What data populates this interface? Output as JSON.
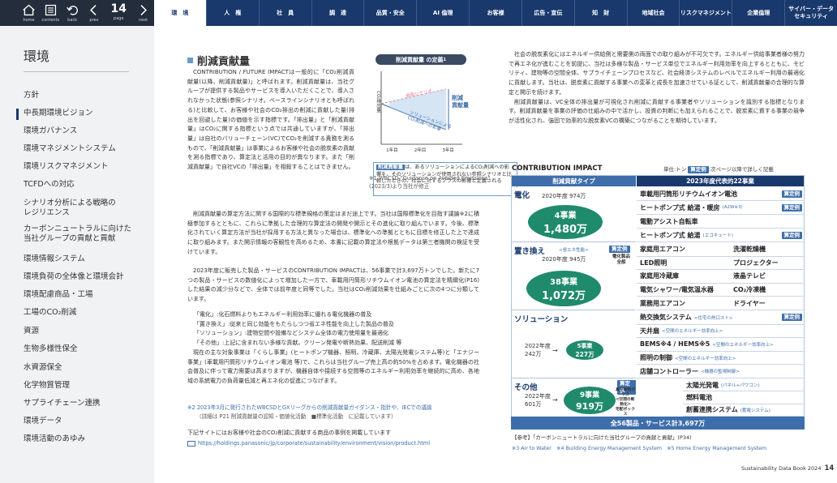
{
  "viewer": {
    "home": "home",
    "contents": "contents",
    "back": "back",
    "prev": "prev",
    "page": "14",
    "page_label": "page",
    "next": "next"
  },
  "tabs": [
    "環　境",
    "人　権",
    "社　員",
    "調　達",
    "品質・安全",
    "AI 倫理",
    "お客様",
    "広告・宣伝",
    "知　財",
    "地域社会",
    "リスクマネジメント",
    "企業倫理",
    "サイバー・データ\nセキュリティ"
  ],
  "sidebar": {
    "title": "環境",
    "items": [
      "方針",
      "中長期環境ビジョン",
      "環境ガバナンス",
      "環境マネジメントシステム",
      "環境リスクマネジメント",
      "TCFDへの対応",
      "シナリオ分析による戦略の\nレジリエンス",
      "カーボンニュートラルに向けた\n当社グループの貢献と貢献",
      "環境情報システム",
      "環境負荷の全体像と環境会計",
      "環境配慮商品・工場",
      "工場のCO₂削減",
      "資源",
      "生物多様性保全",
      "水資源保全",
      "化学物質管理",
      "サプライチェーン連携",
      "環境データ",
      "環境活動のあゆみ"
    ]
  },
  "section": {
    "title": "削減貢献量",
    "p1": "CONTRIBUTION / FUTURE IMPACTは一般的に「CO₂削減貢献量(以降、削減貢献量)」と呼ばれます。削減貢献量は、当社グループが提供する製品やサービスを導入いただくことで、導入されなかった状態(参照シナリオ。ベースラインシナリオとも呼ばれる)と比較して、お客様や社会のCO₂排出の削減に貢献した量(排出を回避した量)の価値を示す指標です。「排出量」と「削減貢献量」はCO₂に関する指標という点では共通していますが、「排出量」は自社のバリューチェーン(VC)でCO₂を削減する責務を測るもので、「削減貢献量」は事業によるお客様や社会の脱炭素の貢献を測る指標であり、算定法と活用の目的が異なります。また「削減貢献量」で自社VCの「排出量」を相殺することはできません。",
    "p2": "削減貢献量の算定方法に関する国際的な標準規格の策定はまだ途上です。当社は国際標準化を目指す議論※2に積極参加するとともに、これらに準拠した合理的な算定法の開発や開示とその進化に取り組んでいます。今後、標準化されていく算定方法が当社が採用する方法と異なった場合は、標準化への準拠とともに目標を修正した上で達成に取り組みます。また開示情報の客観性を高めるため、本書に記載の算定法や根拠データは第三者機関の検証を受けています。",
    "p3": "2023年度に販売した製品・サービスのCONTRIBUTION IMPACTは、56事業で計3,697万トンでした。新たに7つの製品・サービスの数値化によって増加した一方で、車載用円筒形リチウムイオン電池の算定法を精緻化(P16)した結果の減少分などで、全体では前年度と同等でした。当社はCO₂削減効果を仕組みごとに次の4つに分類しています。",
    "list": [
      "「電化」:化石燃料よりもエネルギー利用効率に優れる電化機器の普及",
      "「置き換え」:従来と同じ効能をもたらしつつ省エネ性能を向上した製品の普及",
      "「ソリューション」:建物空間や設備などシステム全体の電力使用量を最適化",
      "「その他」:上記に含まれない多様な貢献。クリーン発電や断熱効果、配送削減 等"
    ],
    "p4": "現在の主な対象事業は「くらし事業」(ヒートポンプ機器、照明、冷蔵庫、太陽光発電システム等)と「エナジー事業」(車載用円筒形リチウムイオン電池 等)で、これらは当社グループ売上高の約50%を占めます。電化機器の社会普及に伴って電力需要は高まりますが、機器自体や接続する空間等のエネルギー利用効率を継続的に高め、各地域の系統電力の負荷量低減と再エネ化の促進につなげます。",
    "fn2": "※2 2023年3月に発行されたWBCSDとGXリーグからの削減貢献量ガイダンス・指針や、IECでの議論",
    "fn2b": "（詳細は P21 削減貢献量の認知・価値化活動　■標準化活動　に記載しています）",
    "link_lead": "下記サイトにはお客様や社会のCO₂削減に貢献する商品の事例を掲載しています",
    "url": "https://holdings.panasonic/jp/corporate/sustainability/environment/vision/product.html"
  },
  "definition": {
    "title": "削減貢献量 の定義",
    "sup": "1",
    "ylabel": "CO₂排出量",
    "ref_line": "参照シナリオ",
    "sol_line": "ソリューションによる\nCO₂削減への影響",
    "arrow_label": "削減\n貢献量",
    "x_ticks": [
      "1年目",
      "2年目",
      "3年目"
    ],
    "note_head": "削減貢献量",
    "note": "は、あるソリューションによるCO₂削減への影響を、そのソリューションが使用されない参照シナリオと比較したときの、社会に対するプラスの影響と定義される"
  },
  "fn1": "※1 WBCSD \"Guidance on Avoided Emissions\" (2023/3)より当社が修正",
  "right": {
    "p1": "社会の脱炭素化にはエネルギー供給側と需要側の両面での取り組みが不可欠です。エネルギー供給事業者様の努力で再エネ化が進むことを前提に、当社は多様な製品・サービス単位でエネルギー利用効率を向上するとともに、モビリティ、建物等の空間全体、サプライチェーンプロセスなど、社会経済システムのレベルでエネルギー利用の最適化に貢献します。当社は、脱炭素に貢献する事業への変革と成長を加速させている証として、削減貢献量の合理的な算定と開示を続けます。",
    "p2": "削減貢献量は、VC全体の排出量が可視化され削減に貢献する事業者やソリューションを識別する指標となります。削減貢献量を事業の評価の仕組みの中で活かし、投資の判断にも加えられることで、脱炭素に資する事業の競争が活性化され、強固で効率的な脱炭素VCの構築につながることを期待しています。"
  },
  "table": {
    "title": "CONTRIBUTION IMPACT",
    "unit": "単位:トン",
    "unit_badge": "算定例",
    "unit_note": ":次ページ以降で詳しく記載",
    "col1": "削減貢献タイプ",
    "col2": "2023年度代表的22事業",
    "elec": {
      "name": "電化",
      "prev": "2020年度 974万",
      "count": "4事業",
      "amount": "1,480万"
    },
    "repl": {
      "name": "置き換え",
      "sub": "<省エネ性能>",
      "prev": "2020年度 945万",
      "count": "38事業",
      "amount": "1,072万",
      "badge": "算定例",
      "extra": "電化製品\n全般"
    },
    "sol": {
      "name": "ソリューション",
      "prev": "2022年度\n242万",
      "count": "5事業",
      "amount": "227万"
    },
    "other": {
      "name": "その他",
      "prev": "2022年度\n601万",
      "count": "9事業",
      "amount": "919万",
      "badge": "算定例",
      "extra": "真空断熱ガラス\n<空間の断熱化>\n宅配ボックス\n<再配達の削減>"
    },
    "elec_rows": [
      {
        "t": "車載用円筒形リチウムイオン電池",
        "b": "算定例"
      },
      {
        "t": "ヒートポンプ式 給湯・暖房",
        "s": "(A2W※3)",
        "b": "算定例"
      },
      {
        "t": "電動アシスト自転車"
      },
      {
        "t": "ヒートポンプ式 給湯",
        "s": "(エコキュート)",
        "b": "算定例"
      }
    ],
    "repl_rows": [
      [
        "家庭用エアコン",
        "洗濯乾燥機"
      ],
      [
        "LED照明",
        "プロジェクター"
      ],
      [
        "家庭用冷蔵庫",
        "液晶テレビ"
      ],
      [
        "電気シャワー/電気温水器",
        "CO₂冷凍機"
      ],
      [
        "業務用エアコン",
        "ドライヤー"
      ]
    ],
    "sol_rows": [
      {
        "t": "熱交換気システム",
        "s": "<住宅の熱口スト>",
        "b": "算定例"
      },
      {
        "t": "天井扇",
        "s": "<空間のエネルギー効率向上>"
      },
      {
        "t": "BEMS※4 / HEMS※5",
        "s": "<空間のエネルギー効率向上>"
      },
      {
        "t": "照明の制御",
        "s": "<空間のエネルギー効率向上>"
      },
      {
        "t": "店舗コントローラー",
        "s": "<機器の監視制御>"
      }
    ],
    "other_rows": [
      {
        "t": "太陽光発電",
        "s": "(パネル+パワコン)"
      },
      {
        "t": "燃料電池"
      },
      {
        "t": "創蓄連携システム",
        "s": "(蓄電システム)"
      }
    ],
    "total": "全56製品・サービス計3,697万"
  },
  "ref": "【参考】「カーボンニュートラルに向けた当社グループの貢献と貢献」(P34)",
  "notes": "※3 Air to Water　※4 Building Energy Management System　※5 Home Energy Management System",
  "footer": {
    "doc": "Sustainability Data Book 2024",
    "page": "14"
  }
}
